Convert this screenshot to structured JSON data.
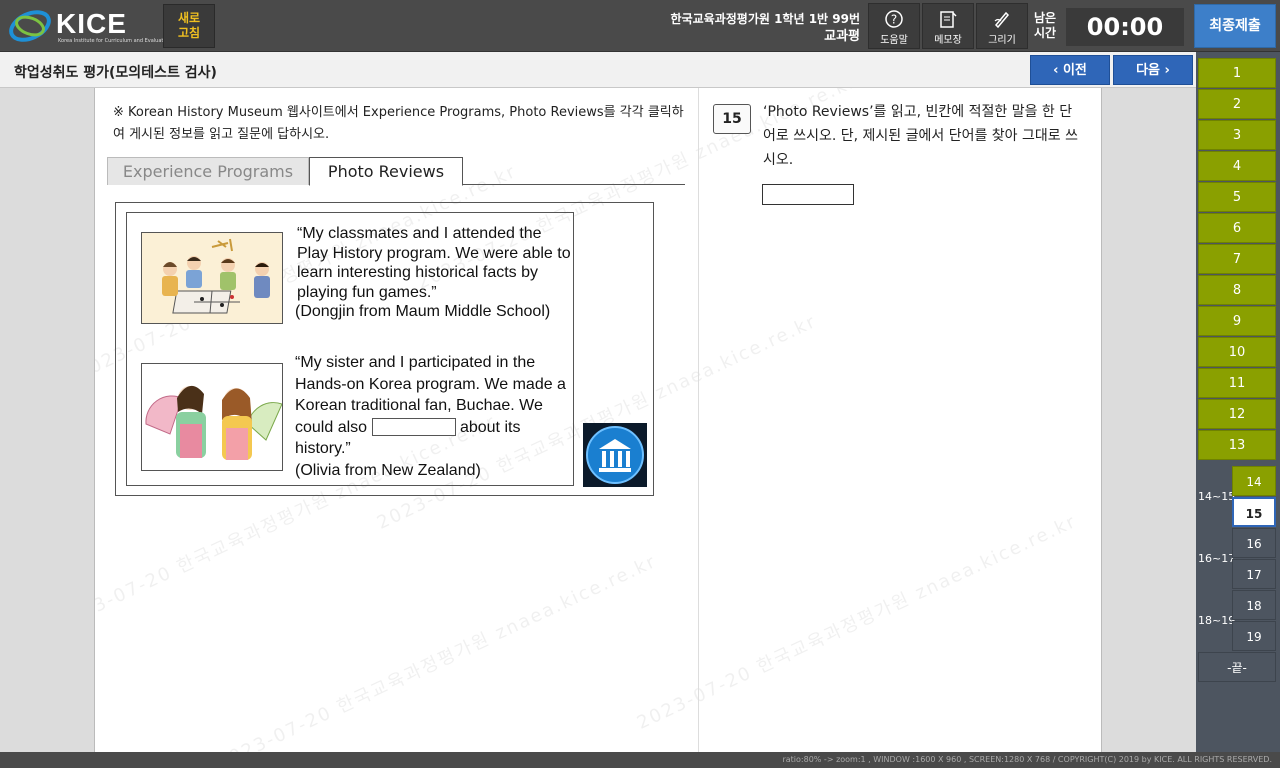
{
  "header": {
    "logo_text": "KICE",
    "logo_sub": "Korea Institute for Curriculum and Evaluation",
    "refresh_line1": "새로",
    "refresh_line2": "고침",
    "school": "한국교육과정평가원 1학년 1반 99번",
    "student": "교과평",
    "tools": {
      "help": "도움말",
      "memo": "메모장",
      "draw": "그리기"
    },
    "time_label_1": "남은",
    "time_label_2": "시간",
    "timer": "00:00",
    "submit": "최종제출"
  },
  "titlebar": {
    "title": "학업성취도 평가(모의테스트 검사)",
    "prev": "‹ 이전",
    "next": "다음 ›"
  },
  "passage": {
    "instruction": "※ Korean History Museum 웹사이트에서 Experience Programs, Photo Reviews를 각각 클릭하여 게시된 정보를 읽고 질문에 답하시오.",
    "tabs": [
      "Experience Programs",
      "Photo Reviews"
    ],
    "review1": {
      "quote": "“My classmates and I attended the Play History program. We were able to learn interesting historical facts by playing fun games.”",
      "author": "(Dongjin from Maum Middle School)"
    },
    "review2": {
      "quote_start": "“My sister and I participated in the Hands-on Korea program. We made a Korean traditional fan, Buchae. We could also",
      "quote_end": "about its history.”",
      "author": "(Olivia from New Zealand)"
    }
  },
  "question": {
    "number": "15",
    "text": "‘Photo Reviews’를 읽고, 빈칸에 적절한 말을 한 단어로 쓰시오. 단, 제시된 글에서 단어를 찾아 그대로 쓰시오.",
    "answer_value": ""
  },
  "qnav": {
    "items": [
      "1",
      "2",
      "3",
      "4",
      "5",
      "6",
      "7",
      "8",
      "9",
      "10",
      "11",
      "12",
      "13"
    ],
    "groups": [
      {
        "label": "14~15",
        "subs": [
          "14",
          "15"
        ]
      },
      {
        "label": "16~17",
        "subs": [
          "16",
          "17"
        ]
      },
      {
        "label": "18~19",
        "subs": [
          "18",
          "19"
        ]
      }
    ],
    "end": "-끝-"
  },
  "watermark_text": "2023-07-20 한국교육과정평가원 znaea.kice.re.kr",
  "footer": "ratio:80% -> zoom:1 , WINDOW :1600 X 960 , SCREEN:1280 X 768 / COPYRIGHT(C) 2019 by KICE. ALL RIGHTS RESERVED.",
  "colors": {
    "accent": "#2f66b8",
    "answered": "#8aa000",
    "submit": "#3d7fc9"
  }
}
